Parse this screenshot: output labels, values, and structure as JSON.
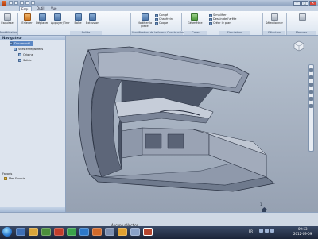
{
  "window": {
    "title": "",
    "controls": {
      "minimize": "–",
      "maximize": "□",
      "close": "×"
    }
  },
  "tabs": [
    {
      "label": "Esqu"
    },
    {
      "label": "Outil"
    },
    {
      "label": "Vue"
    }
  ],
  "ribbon": {
    "buttons": [
      {
        "label": "Esquisse"
      },
      {
        "label": "Enlever"
      },
      {
        "label": "Déplacer"
      },
      {
        "label": "Appuyer/Tirer"
      },
      {
        "label": "Boîte"
      },
      {
        "label": "Extrusion"
      },
      {
        "label": "Modifier la pièce"
      },
      {
        "label": "Géométrie"
      },
      {
        "label": "Sélectionner"
      }
    ],
    "small_items": [
      "Congé",
      "Chanfrein",
      "Coque",
      "Simplifier",
      "Dessin de l'arête",
      "Créer le plan"
    ],
    "groups": [
      {
        "label": "Modélisation"
      },
      {
        "label": "Solide"
      },
      {
        "label": "Modification de la forme"
      },
      {
        "label": "Construction"
      },
      {
        "label": "Créer"
      },
      {
        "label": "Simulation"
      },
      {
        "label": "Sélection"
      },
      {
        "label": "Mesurer"
      }
    ]
  },
  "browser": {
    "title": "Navigateur",
    "items": [
      {
        "label": "Document1"
      },
      {
        "label": "Vues enregistrées"
      },
      {
        "label": "Origine"
      },
      {
        "label": "Solide"
      }
    ],
    "favorites_title": "Favoris",
    "favorites_item": "Mes Favoris"
  },
  "viewport": {
    "view_count": "1"
  },
  "status": {
    "text": "Aucune sélection"
  },
  "taskbar": {
    "language": "FR",
    "time": "09:53",
    "date": "2012-09-09"
  }
}
